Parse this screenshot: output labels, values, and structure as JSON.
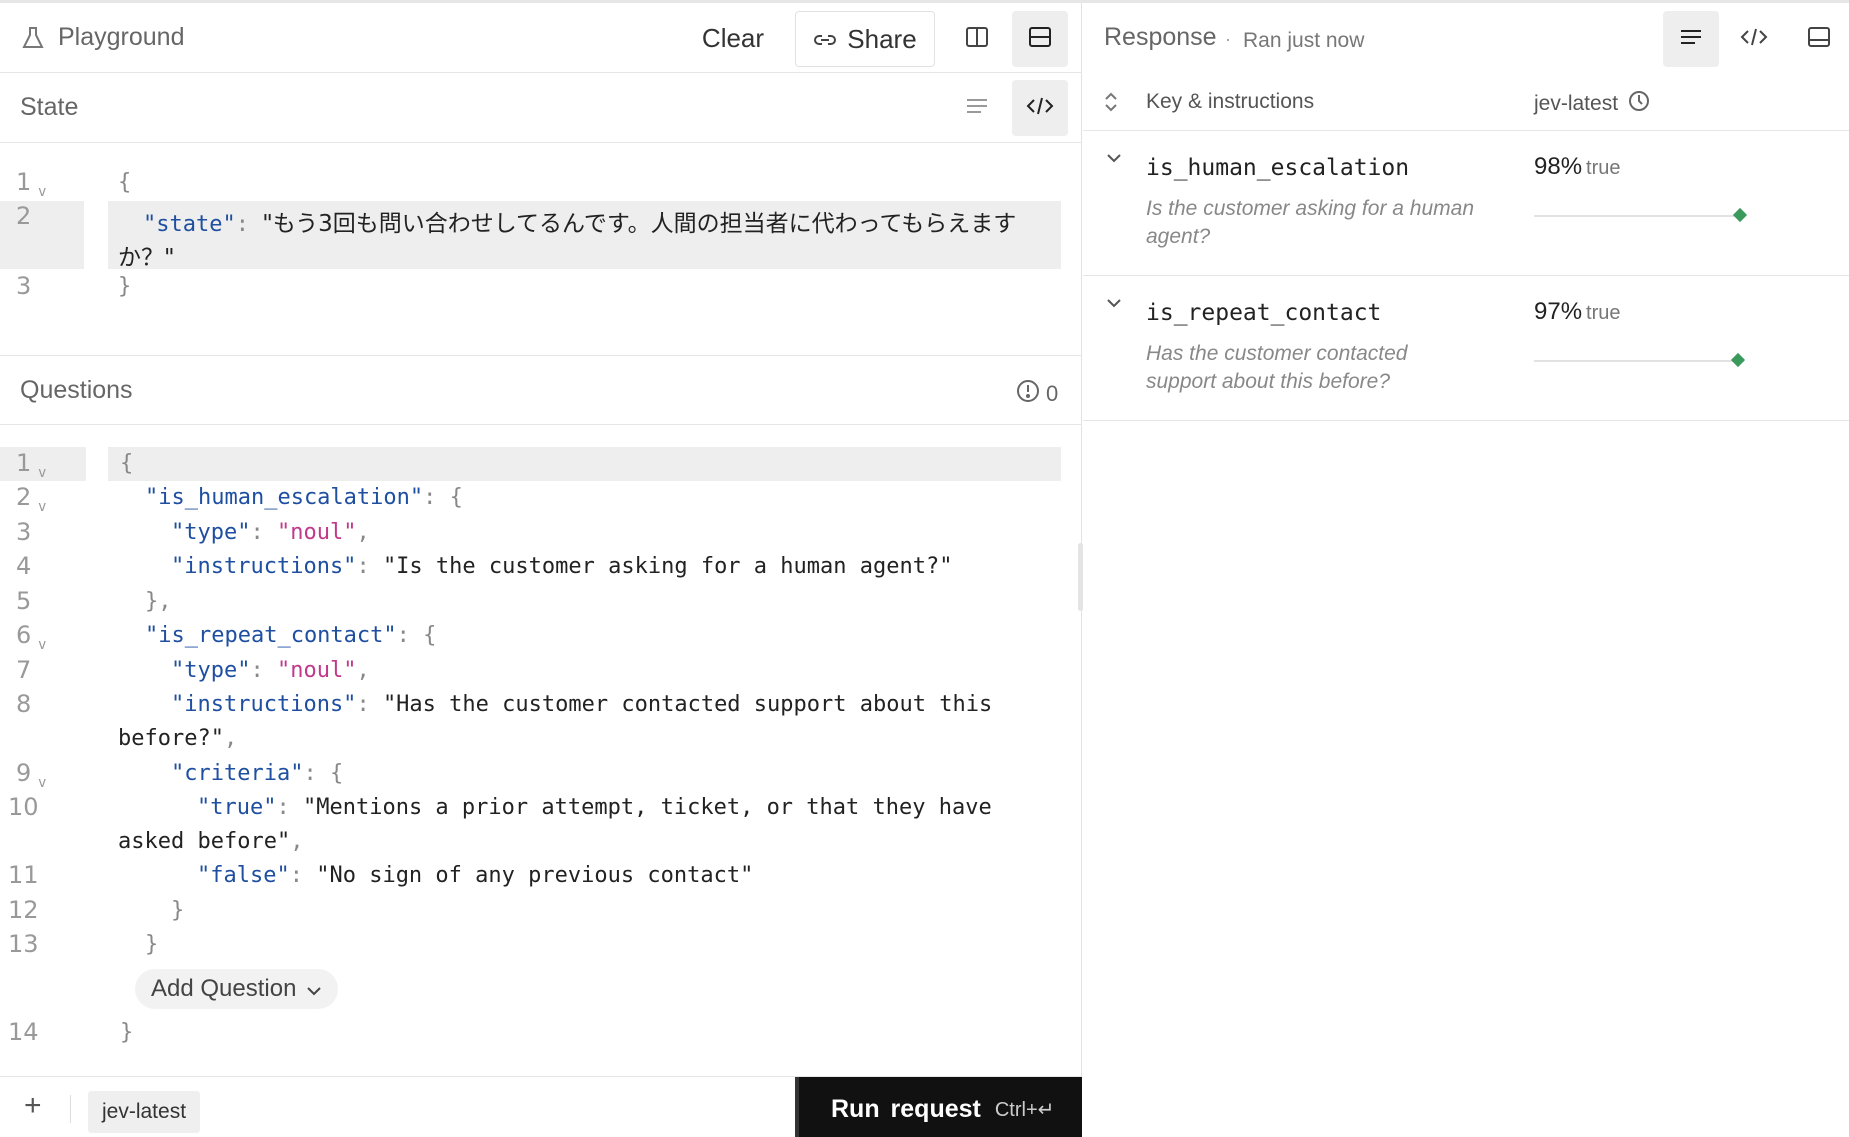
{
  "topbar": {
    "title": "Playground",
    "clear_label": "Clear",
    "share_label": "Share"
  },
  "state_section": {
    "title": "State",
    "lines": [
      {
        "n": "1"
      },
      {
        "n": "2",
        "key": "\"state\"",
        "value": "\"もう3回も問い合わせしてるんです。人間の担当者に代わってもらえます",
        "wrap": "か？\""
      },
      {
        "n": "3"
      }
    ]
  },
  "questions_section": {
    "title": "Questions",
    "issue_count": "0",
    "line_numbers": [
      "1",
      "2",
      "3",
      "4",
      "5",
      "6",
      "7",
      "8",
      "9",
      "10",
      "11",
      "12",
      "13",
      "14"
    ],
    "q1_key": "\"is_human_escalation\"",
    "q2_key": "\"is_repeat_contact\"",
    "type_key": "\"type\"",
    "type_val": "\"noul\"",
    "instructions_key": "\"instructions\"",
    "q1_instructions": "\"Is the customer asking for a human agent?\"",
    "q2_instructions": "\"Has the customer contacted support about this",
    "q2_instructions_wrap": "before?\"",
    "criteria_key": "\"criteria\"",
    "true_key": "\"true\"",
    "true_val": "\"Mentions a prior attempt, ticket, or that they have",
    "true_val_wrap": "asked before\"",
    "false_key": "\"false\"",
    "false_val": "\"No sign of any previous contact\"",
    "add_question_label": "Add Question"
  },
  "bottombar": {
    "model": "jev-latest",
    "run_label": "Run request",
    "run_shortcut": "Ctrl+↵"
  },
  "response": {
    "title": "Response",
    "separator": "·",
    "ran": "Ran just now",
    "col_key": "Key & instructions",
    "col_model": "jev-latest",
    "rows": [
      {
        "key": "is_human_escalation",
        "instructions": "Is the customer asking for a human agent?",
        "pct": "98%",
        "value": "true",
        "confidence": 0.98
      },
      {
        "key": "is_repeat_contact",
        "instructions": "Has the customer contacted support about this before?",
        "pct": "97%",
        "value": "true",
        "confidence": 0.97
      }
    ]
  },
  "colors": {
    "json_key": "#1f4fa0",
    "json_keyword": "#c0398b",
    "confidence_marker": "#3a9a5b",
    "run_button": "#111111"
  }
}
